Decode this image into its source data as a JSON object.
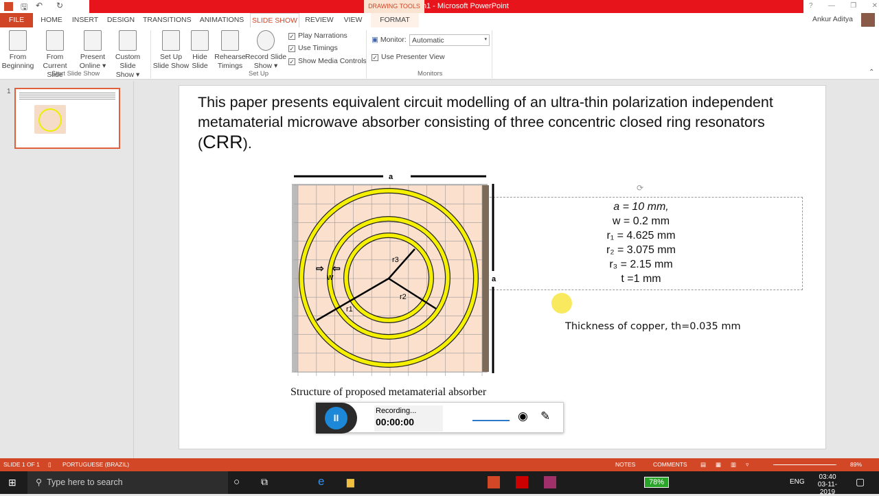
{
  "window": {
    "title": "Presentation1 - Microsoft PowerPoint",
    "context_tab": "DRAWING TOOLS",
    "user": "Ankur Aditya",
    "help": "?",
    "minimize": "—",
    "restore": "❐",
    "close": "✕"
  },
  "tabs": [
    "FILE",
    "HOME",
    "INSERT",
    "DESIGN",
    "TRANSITIONS",
    "ANIMATIONS",
    "SLIDE SHOW",
    "REVIEW",
    "VIEW",
    "FORMAT"
  ],
  "active_tab": "SLIDE SHOW",
  "ribbon": {
    "start_group": "Start Slide Show",
    "setup_group": "Set Up",
    "monitors_group": "Monitors",
    "buttons": [
      {
        "l1": "From",
        "l2": "Beginning"
      },
      {
        "l1": "From",
        "l2": "Current Slide"
      },
      {
        "l1": "Present",
        "l2": "Online ▾"
      },
      {
        "l1": "Custom Slide",
        "l2": "Show ▾"
      },
      {
        "l1": "Set Up",
        "l2": "Slide Show"
      },
      {
        "l1": "Hide",
        "l2": "Slide"
      },
      {
        "l1": "Rehearse",
        "l2": "Timings"
      },
      {
        "l1": "Record Slide",
        "l2": "Show ▾"
      }
    ],
    "checks": [
      {
        "label": "Play Narrations",
        "checked": true
      },
      {
        "label": "Use Timings",
        "checked": true
      },
      {
        "label": "Show Media Controls",
        "checked": true
      }
    ],
    "monitor_label": "Monitor:",
    "monitor_value": "Automatic",
    "presenter_view": "Use Presenter View"
  },
  "thumbnail": {
    "number": "1"
  },
  "slide": {
    "body": "This paper presents equivalent circuit modelling of an ultra-thin polarization independent metamaterial microwave absorber consisting of three concentric closed ring resonators (",
    "acronym": "CRR",
    "body_end": ").",
    "dim_a_top": "a",
    "dim_a_side": "a",
    "label_w": "w",
    "label_r1": "r1",
    "label_r2": "r2",
    "label_r3": "r3",
    "params": [
      "a = 10 mm,",
      "w = 0.2 mm",
      "r₁ = 4.625 mm",
      "r₂ = 3.075 mm",
      "r₃ = 2.15 mm",
      "t =1 mm"
    ],
    "thickness": "Thickness of copper, th=0.035 mm",
    "caption": "Structure of proposed metamaterial absorber"
  },
  "recorder": {
    "status": "Recording...",
    "time": "00:00:00"
  },
  "status": {
    "slide": "SLIDE 1 OF 1",
    "language": "PORTUGUESE (BRAZIL)",
    "notes": "NOTES",
    "comments": "COMMENTS",
    "zoom": "89%"
  },
  "taskbar": {
    "search_placeholder": "Type here to search",
    "battery": "78%",
    "lang": "ENG",
    "time": "03:40",
    "date": "03-11-2019"
  },
  "colors": {
    "accent": "#d24726",
    "title_red": "#e8141b",
    "ring": "#f5f000"
  }
}
